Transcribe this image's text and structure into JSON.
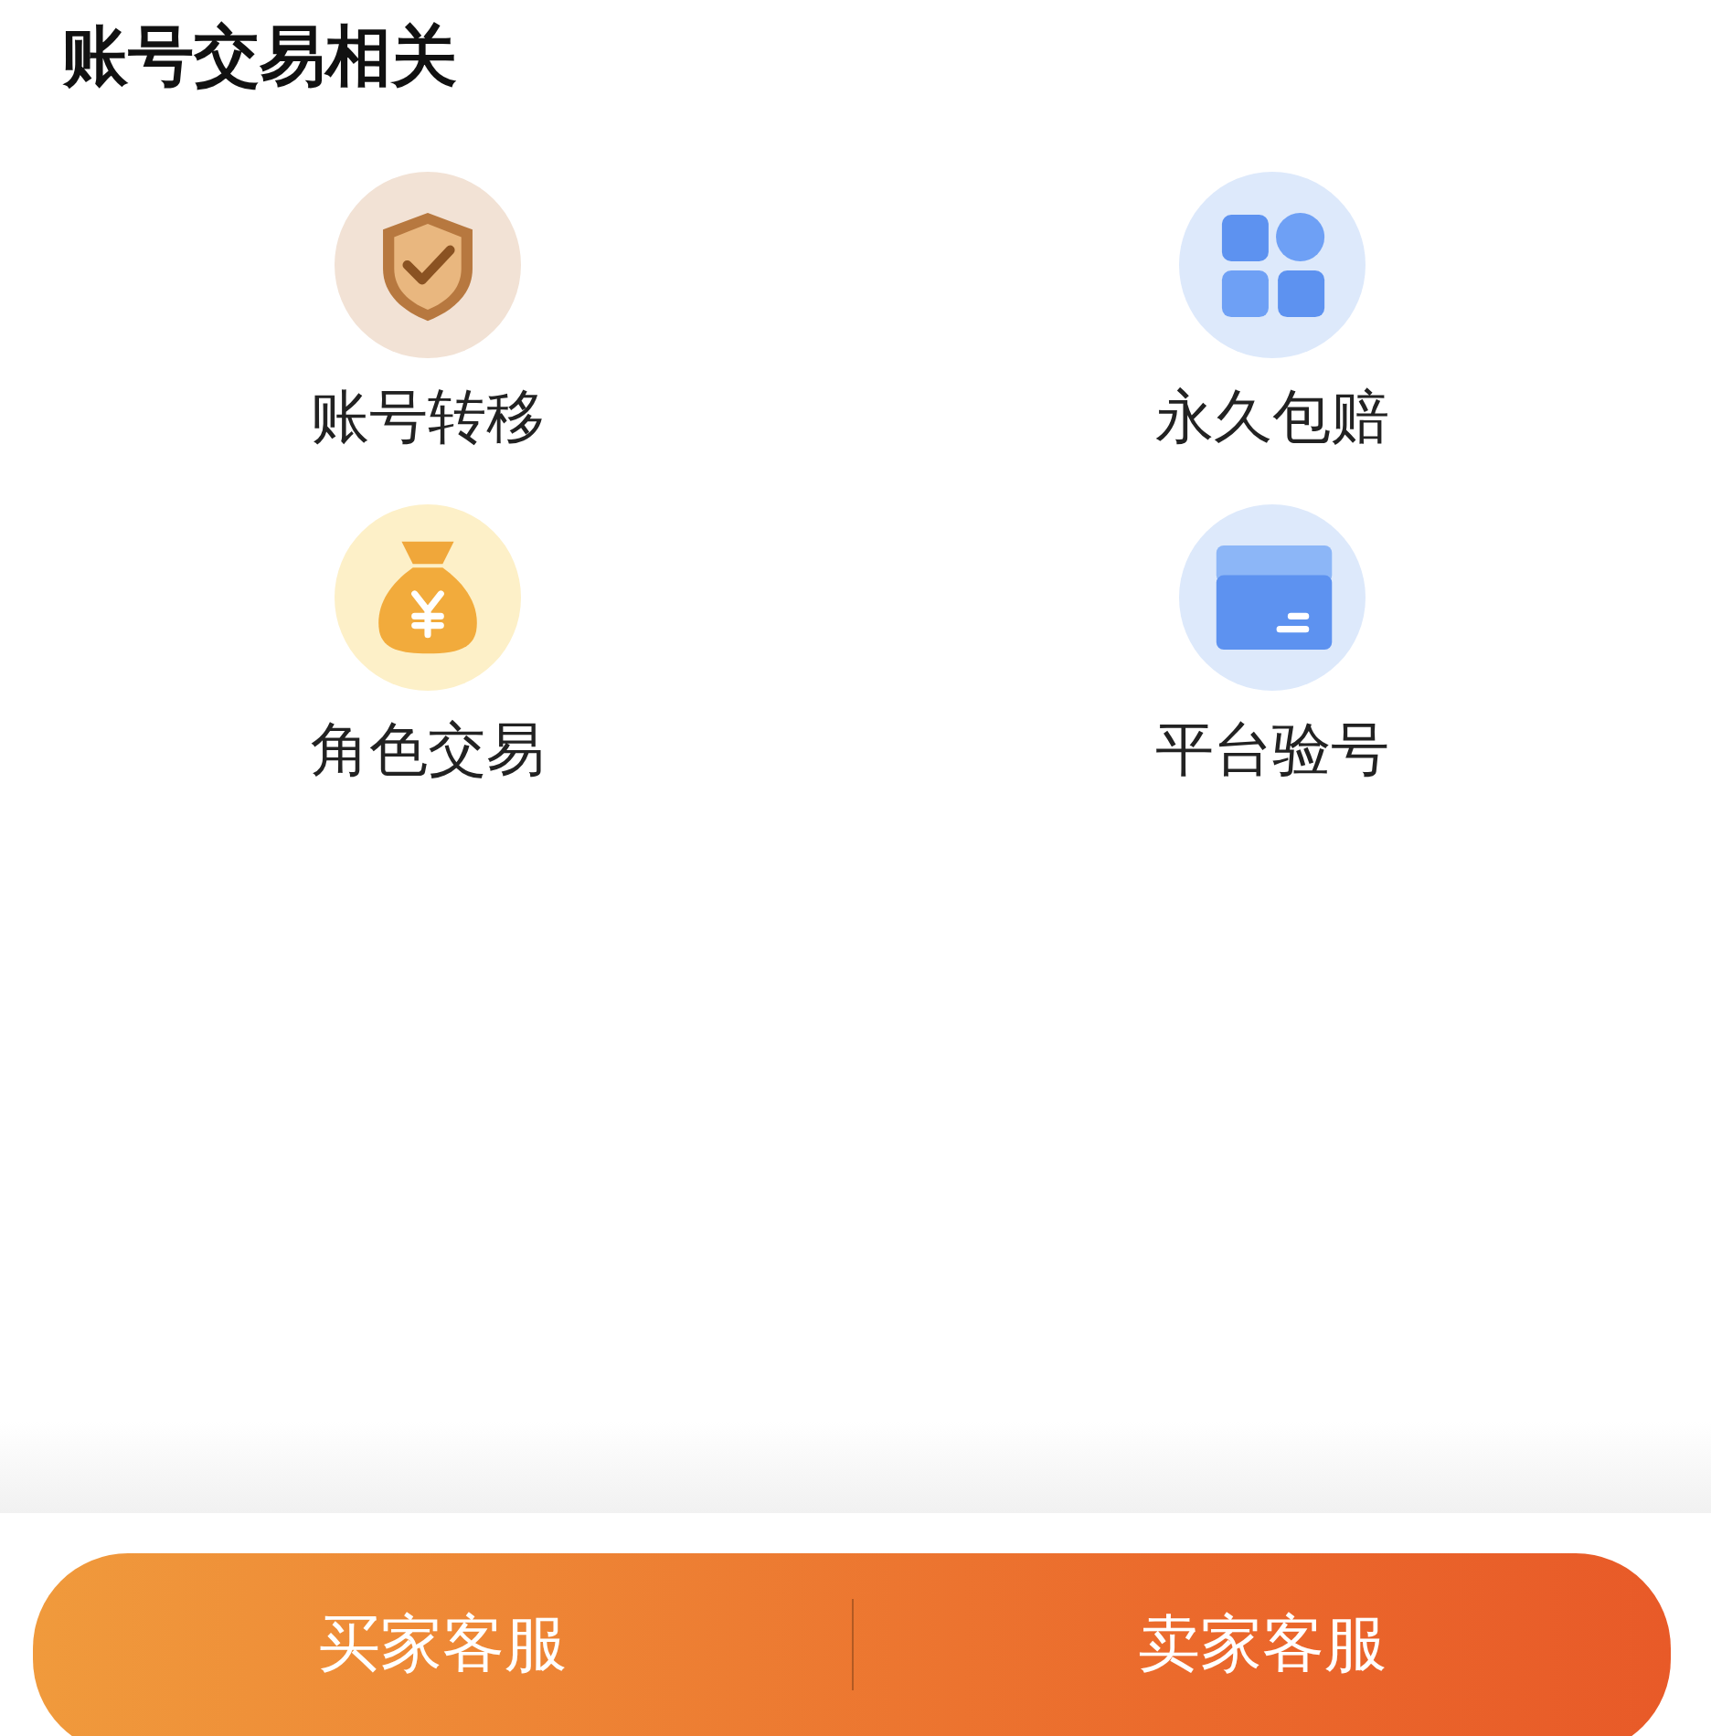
{
  "section": {
    "title": "账号交易相关"
  },
  "items": [
    {
      "label": "账号转移",
      "kind": "shield"
    },
    {
      "label": "永久包赔",
      "kind": "blocks"
    },
    {
      "label": "角色交易",
      "kind": "moneybag"
    },
    {
      "label": "平台验号",
      "kind": "card"
    }
  ],
  "bottom_bar": {
    "buttons": [
      "买家客服",
      "卖家客服"
    ]
  }
}
